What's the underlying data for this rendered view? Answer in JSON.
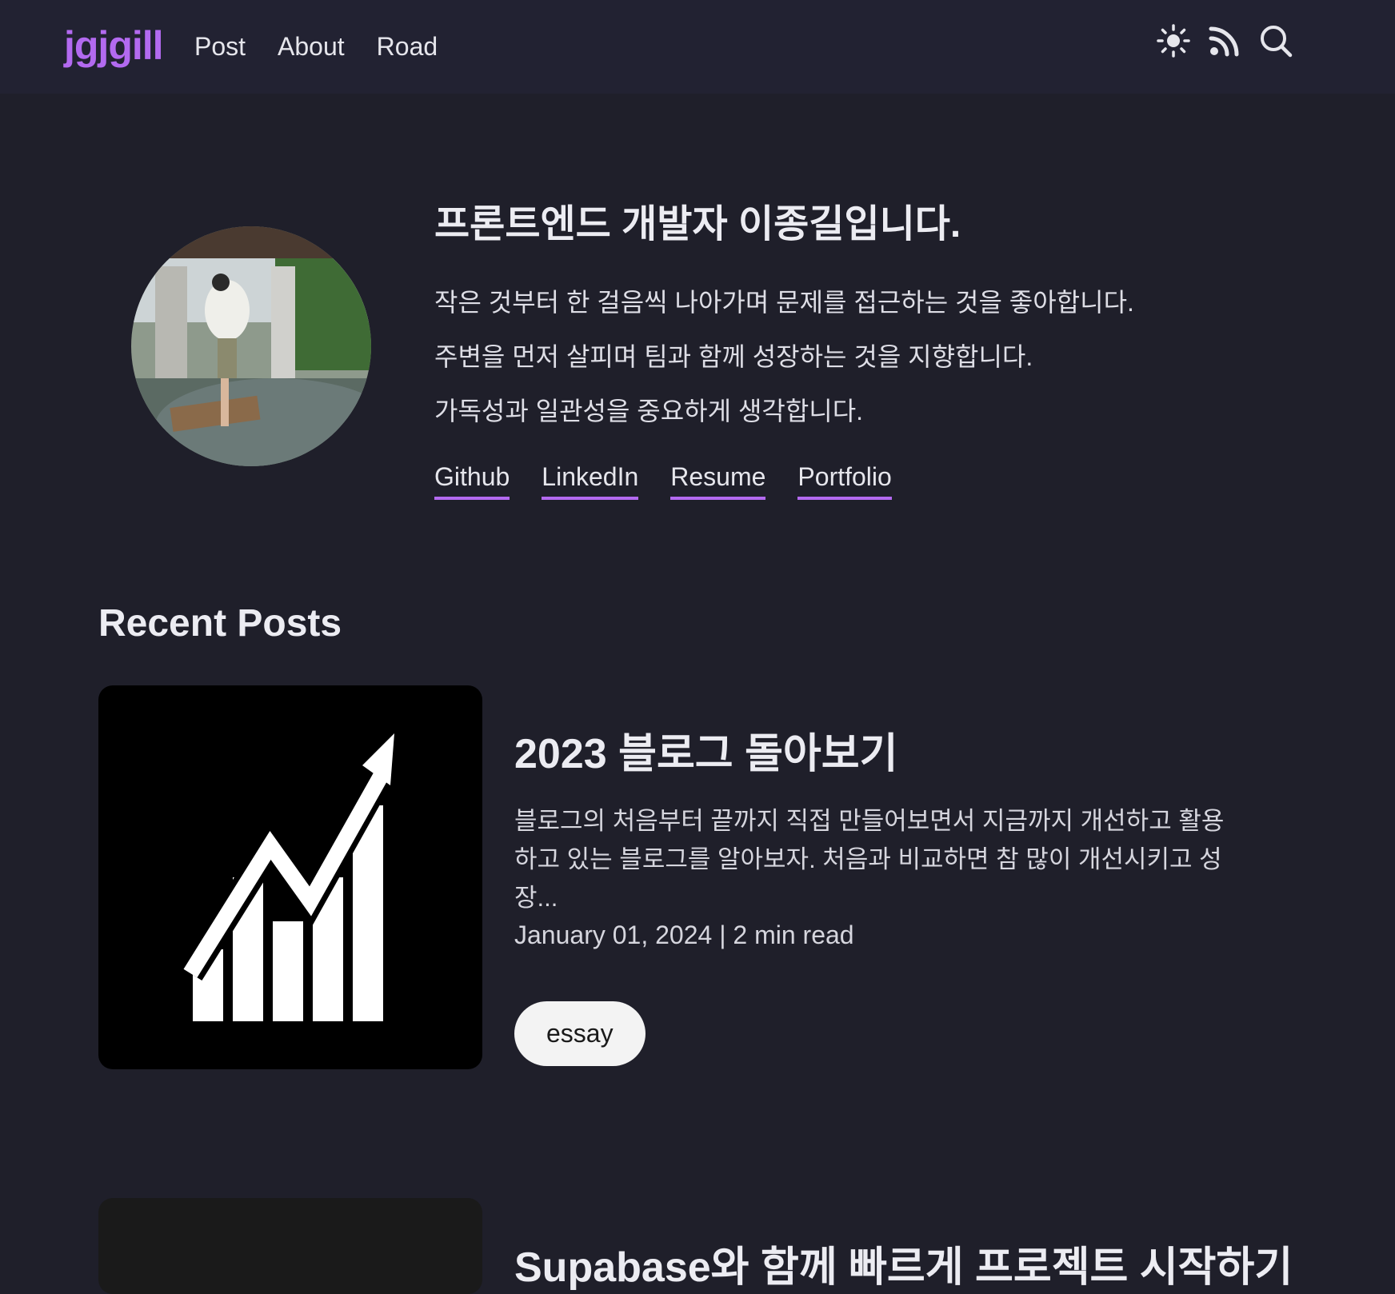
{
  "header": {
    "logo": "jgjgill",
    "nav": [
      "Post",
      "About",
      "Road"
    ],
    "icons": [
      "sun-icon",
      "rss-icon",
      "search-icon"
    ]
  },
  "intro": {
    "heading": "프론트엔드 개발자 이종길입니다.",
    "lines": [
      "작은 것부터 한 걸음씩 나아가며 문제를 접근하는 것을 좋아합니다.",
      "주변을 먼저 살피며 팀과 함께 성장하는 것을 지향합니다.",
      "가독성과 일관성을 중요하게 생각합니다."
    ],
    "links": [
      "Github",
      "LinkedIn",
      "Resume",
      "Portfolio"
    ]
  },
  "recent": {
    "title": "Recent Posts",
    "posts": [
      {
        "title": "2023 블로그 돌아보기",
        "excerpt": "블로그의 처음부터 끝까지 직접 만들어보면서 지금까지 개선하고 활용하고 있는 블로그를 알아보자. 처음과 비교하면 참 많이 개선시키고 성장...",
        "meta": "January 01, 2024 | 2 min read",
        "tag": "essay"
      },
      {
        "title": "Supabase와 함께 빠르게 프로젝트 시작하기"
      }
    ]
  },
  "colors": {
    "accent": "#b36af0",
    "background": "#1f1f2a",
    "header": "#222232"
  }
}
